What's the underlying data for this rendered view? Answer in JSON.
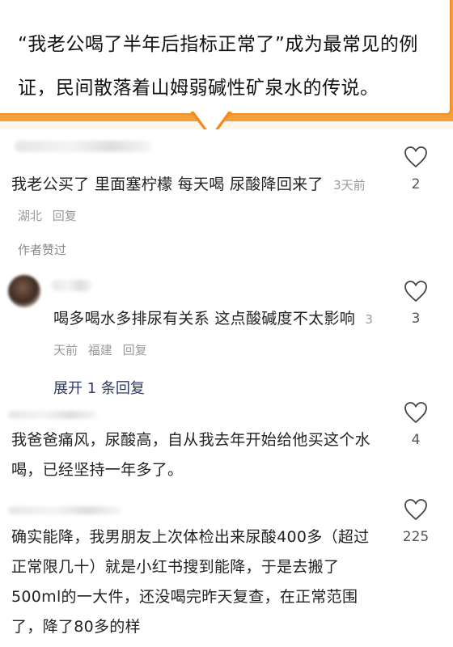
{
  "header": {
    "callout_text": "“我老公喝了半年后指标正常了”成为最常见的例证，民间散落着山姆弱碱性矿泉水的传说。",
    "accent_color": "#f08c23"
  },
  "comments": [
    {
      "text": "我老公买了 里面塞柠檬 每天喝 尿酸降回来了",
      "time": "3天前",
      "location": "湖北",
      "reply_label": "回复",
      "likes": "2",
      "author_liked": "作者赞过",
      "icon": "heart-outline-icon"
    },
    {
      "text": "喝多喝水多排尿有关系 这点酸碱度不太影响",
      "time": "3天前",
      "location": "福建",
      "reply_label": "回复",
      "likes": "3",
      "expand_label": "展开 1 条回复",
      "icon": "heart-outline-icon"
    },
    {
      "text": "我爸爸痛风，尿酸高，自从我去年开始给他买这个水喝，已经坚持一年多了。",
      "likes": "4",
      "icon": "heart-outline-icon"
    },
    {
      "text": "确实能降，我男朋友上次体检出来尿酸400多（超过正常限几十）就是小红书搜到能降，于是去搬了500ml的一大件，还没喝完昨天复查，在正常范围了，降了80多的样",
      "likes": "225",
      "icon": "heart-outline-icon"
    }
  ]
}
